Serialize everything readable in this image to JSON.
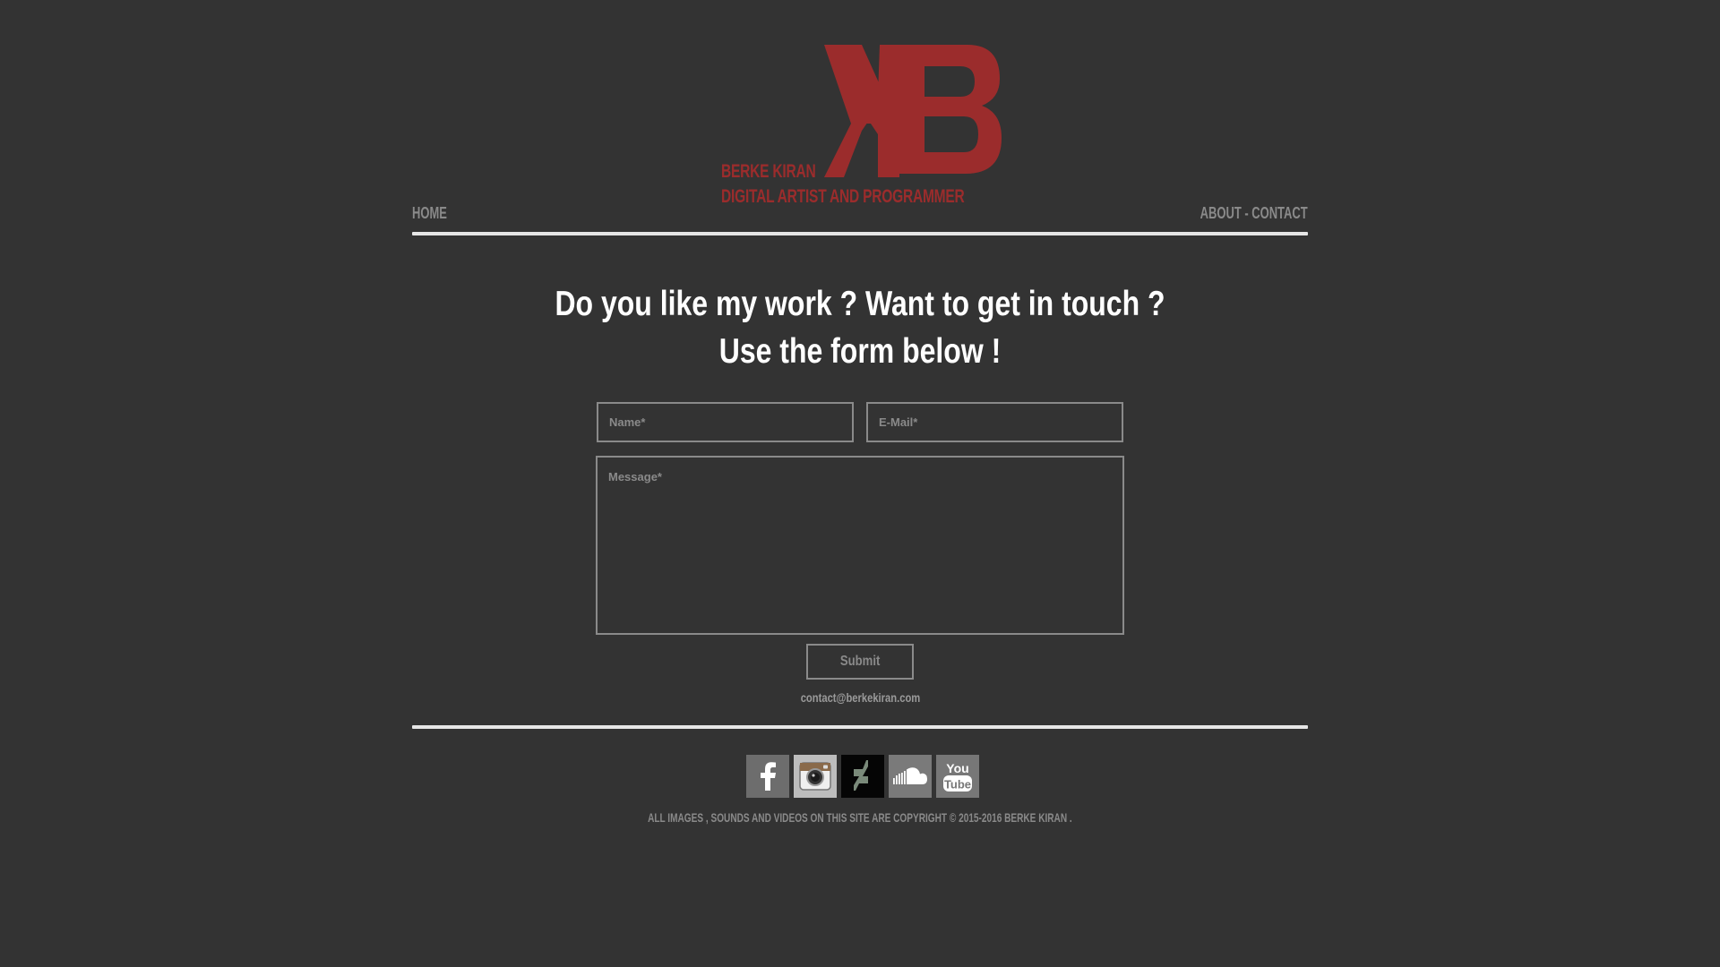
{
  "brand": {
    "logo_letters": "KB",
    "logo_color": "#9b2c2c",
    "name": "BERKE KIRAN",
    "tagline": "DIGITAL ARTIST AND PROGRAMMER"
  },
  "nav": {
    "home": "HOME",
    "about_contact": "ABOUT - CONTACT"
  },
  "headline": {
    "line1": "Do you like my work ? Want to get in touch ?",
    "line2": "Use the form below !"
  },
  "form": {
    "name_placeholder": "Name*",
    "email_placeholder": "E-Mail*",
    "message_placeholder": "Message*",
    "submit_label": "Submit"
  },
  "contact_email": "contact@berkekiran.com",
  "social": [
    {
      "icon": "facebook-icon"
    },
    {
      "icon": "instagram-icon"
    },
    {
      "icon": "deviantart-icon"
    },
    {
      "icon": "soundcloud-icon"
    },
    {
      "icon": "youtube-icon",
      "label_top": "You",
      "label_bottom": "Tube"
    }
  ],
  "footer": {
    "copyright": "ALL IMAGES , SOUNDS AND VIDEOS ON THIS SITE ARE COPYRIGHT © 2015-2016 BERKE KIRAN ."
  },
  "colors": {
    "background": "#333333",
    "rule": "#e6e6e6",
    "muted_text": "#8a8a8a"
  }
}
